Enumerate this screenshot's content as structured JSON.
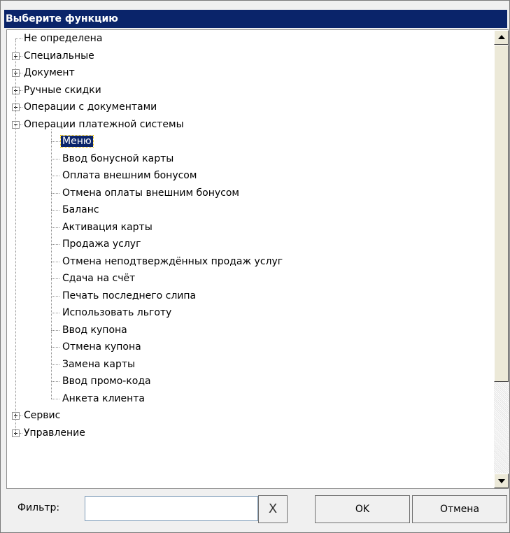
{
  "window": {
    "title": "Выберите функцию"
  },
  "tree": {
    "items": [
      {
        "label": "Не определена",
        "level": 0,
        "expander": "none"
      },
      {
        "label": "Специальные",
        "level": 0,
        "expander": "plus"
      },
      {
        "label": "Документ",
        "level": 0,
        "expander": "plus"
      },
      {
        "label": "Ручные скидки",
        "level": 0,
        "expander": "plus"
      },
      {
        "label": "Операции с документами",
        "level": 0,
        "expander": "plus"
      },
      {
        "label": "Операции платежной системы",
        "level": 0,
        "expander": "minus"
      },
      {
        "label": "Меню",
        "level": 1,
        "expander": "none",
        "selected": true
      },
      {
        "label": "Ввод бонусной карты",
        "level": 1,
        "expander": "none"
      },
      {
        "label": "Оплата внешним бонусом",
        "level": 1,
        "expander": "none"
      },
      {
        "label": "Отмена оплаты внешним бонусом",
        "level": 1,
        "expander": "none"
      },
      {
        "label": "Баланс",
        "level": 1,
        "expander": "none"
      },
      {
        "label": "Активация карты",
        "level": 1,
        "expander": "none"
      },
      {
        "label": "Продажа услуг",
        "level": 1,
        "expander": "none"
      },
      {
        "label": "Отмена неподтверждённых продаж услуг",
        "level": 1,
        "expander": "none"
      },
      {
        "label": "Сдача на счёт",
        "level": 1,
        "expander": "none"
      },
      {
        "label": "Печать последнего слипа",
        "level": 1,
        "expander": "none"
      },
      {
        "label": "Использовать льготу",
        "level": 1,
        "expander": "none"
      },
      {
        "label": "Ввод купона",
        "level": 1,
        "expander": "none"
      },
      {
        "label": "Отмена купона",
        "level": 1,
        "expander": "none"
      },
      {
        "label": "Замена карты",
        "level": 1,
        "expander": "none"
      },
      {
        "label": "Ввод промо-кода",
        "level": 1,
        "expander": "none"
      },
      {
        "label": "Анкета клиента",
        "level": 1,
        "expander": "none"
      },
      {
        "label": "Сервис",
        "level": 0,
        "expander": "plus"
      },
      {
        "label": "Управление",
        "level": 0,
        "expander": "plus"
      }
    ]
  },
  "filter": {
    "label": "Фильтр:",
    "value": "",
    "clear_label": "X"
  },
  "buttons": {
    "ok": "OK",
    "cancel": "Отмена"
  },
  "colors": {
    "titlebar": "#0a246a",
    "selection": "#0a246a"
  }
}
